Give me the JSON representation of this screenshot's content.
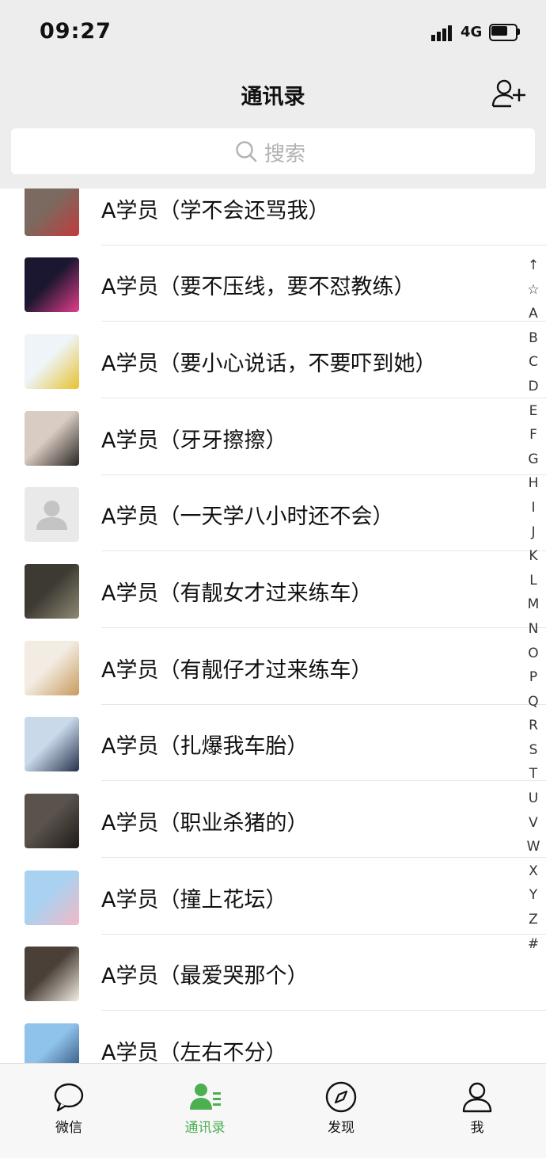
{
  "status_bar": {
    "time": "09:27",
    "network": "4G"
  },
  "nav": {
    "title": "通讯录"
  },
  "search": {
    "placeholder": "搜索"
  },
  "contacts": [
    {
      "name": "A学员（学不会还骂我）",
      "avatar": {
        "bg": "#7a6a5f",
        "accent": "#c23b3b"
      }
    },
    {
      "name": "A学员（要不压线，要不怼教练）",
      "avatar": {
        "bg": "#1c1730",
        "accent": "#e43d8c"
      }
    },
    {
      "name": "A学员（要小心说话，不要吓到她）",
      "avatar": {
        "bg": "#eef4f8",
        "accent": "#e8c12f"
      }
    },
    {
      "name": "A学员（牙牙擦擦）",
      "avatar": {
        "bg": "#d9ccc2",
        "accent": "#2a2522"
      }
    },
    {
      "name": "A学员（一天学八小时还不会）",
      "avatar": {
        "bg": "#e9e9e9",
        "accent": "#c4c4c4"
      }
    },
    {
      "name": "A学员（有靓女才过来练车）",
      "avatar": {
        "bg": "#3d3a33",
        "accent": "#8f8a74"
      }
    },
    {
      "name": "A学员（有靓仔才过来练车）",
      "avatar": {
        "bg": "#f3ece2",
        "accent": "#c79a5c"
      }
    },
    {
      "name": "A学员（扎爆我车胎）",
      "avatar": {
        "bg": "#c9d9ea",
        "accent": "#25304a"
      }
    },
    {
      "name": "A学员（职业杀猪的）",
      "avatar": {
        "bg": "#5a524c",
        "accent": "#1e1b19"
      }
    },
    {
      "name": "A学员（撞上花坛）",
      "avatar": {
        "bg": "#a9d2f0",
        "accent": "#f3b8c5"
      }
    },
    {
      "name": "A学员（最爱哭那个）",
      "avatar": {
        "bg": "#4a4037",
        "accent": "#f2ede4"
      }
    },
    {
      "name": "A学员（左右不分）",
      "avatar": {
        "bg": "#8fc3ec",
        "accent": "#25466c"
      }
    }
  ],
  "index_letters": [
    "↑",
    "☆",
    "A",
    "B",
    "C",
    "D",
    "E",
    "F",
    "G",
    "H",
    "I",
    "J",
    "K",
    "L",
    "M",
    "N",
    "O",
    "P",
    "Q",
    "R",
    "S",
    "T",
    "U",
    "V",
    "W",
    "X",
    "Y",
    "Z",
    "#"
  ],
  "tabs": [
    {
      "label": "微信",
      "icon": "chat-bubble-icon"
    },
    {
      "label": "通讯录",
      "icon": "contacts-icon",
      "active": true
    },
    {
      "label": "发现",
      "icon": "compass-icon"
    },
    {
      "label": "我",
      "icon": "person-icon"
    }
  ],
  "colors": {
    "accent": "#4caf50",
    "header_bg": "#ededed",
    "tabbar_bg": "#f7f7f7"
  }
}
